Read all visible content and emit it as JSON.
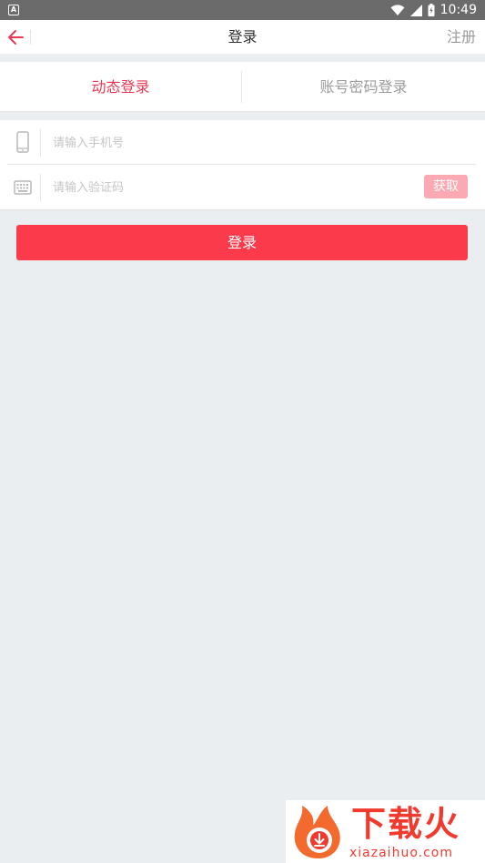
{
  "status_bar": {
    "time": "10:49",
    "app_icon_letter": "A"
  },
  "nav": {
    "title": "登录",
    "register_label": "注册"
  },
  "tabs": [
    {
      "label": "动态登录",
      "active": true
    },
    {
      "label": "账号密码登录",
      "active": false
    }
  ],
  "form": {
    "phone_placeholder": "请输入手机号",
    "code_placeholder": "请输入验证码",
    "get_code_label": "获取"
  },
  "login_button_label": "登录",
  "watermark": {
    "title": "下载火",
    "domain": "xiazaihuo.com"
  },
  "colors": {
    "accent": "#fb3a4c",
    "active_tab": "#e83a55",
    "get_code_bg": "#fbaab3",
    "background": "#ebeef0"
  },
  "icons": [
    "back-arrow-icon",
    "phone-icon",
    "keyboard-icon",
    "wifi-icon",
    "signal-icon",
    "battery-icon"
  ]
}
